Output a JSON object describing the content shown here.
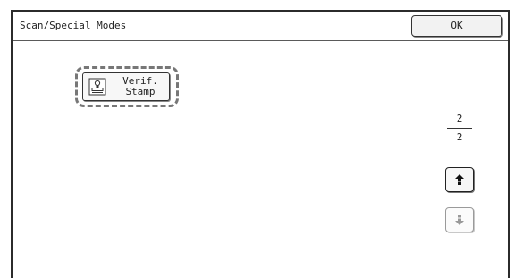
{
  "window": {
    "title": "Scan/Special Modes",
    "ok_label": "OK"
  },
  "modes": [
    {
      "label": "Verif.\nStamp",
      "icon": "verification-stamp-icon",
      "selected": true
    }
  ],
  "pagination": {
    "current": "2",
    "total": "2",
    "up_icon": "arrow-up-icon",
    "down_icon": "arrow-down-icon",
    "up_enabled": true,
    "down_enabled": false
  }
}
